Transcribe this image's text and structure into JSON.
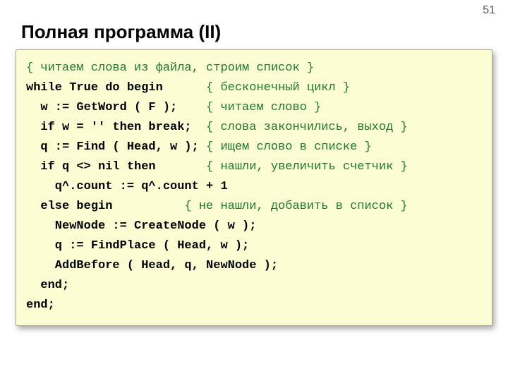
{
  "page_number": "51",
  "title": "Полная программа (II)",
  "code": {
    "c0": "{ читаем слова из файла, строим список }",
    "l1a": "while True do begin      ",
    "c1": "{ бесконечный цикл }",
    "l2a": "  w := GetWord ( F );    ",
    "c2": "{ читаем слово }",
    "l3a": "  if w = '' then break;  ",
    "c3": "{ слова закончились, выход }",
    "l4a": "  q := Find ( Head, w ); ",
    "c4": "{ ищем слово в списке }",
    "l5a": "  if q <> nil then       ",
    "c5": "{ нашли, увеличить счетчик }",
    "l6": "    q^.count := q^.count + 1",
    "l7a": "  else begin          ",
    "c7": "{ не нашли, добавить в список }",
    "l8": "    NewNode := CreateNode ( w );",
    "l9": "    q := FindPlace ( Head, w );",
    "l10": "    AddBefore ( Head, q, NewNode );",
    "l11": "  end;",
    "l12": "end;"
  }
}
